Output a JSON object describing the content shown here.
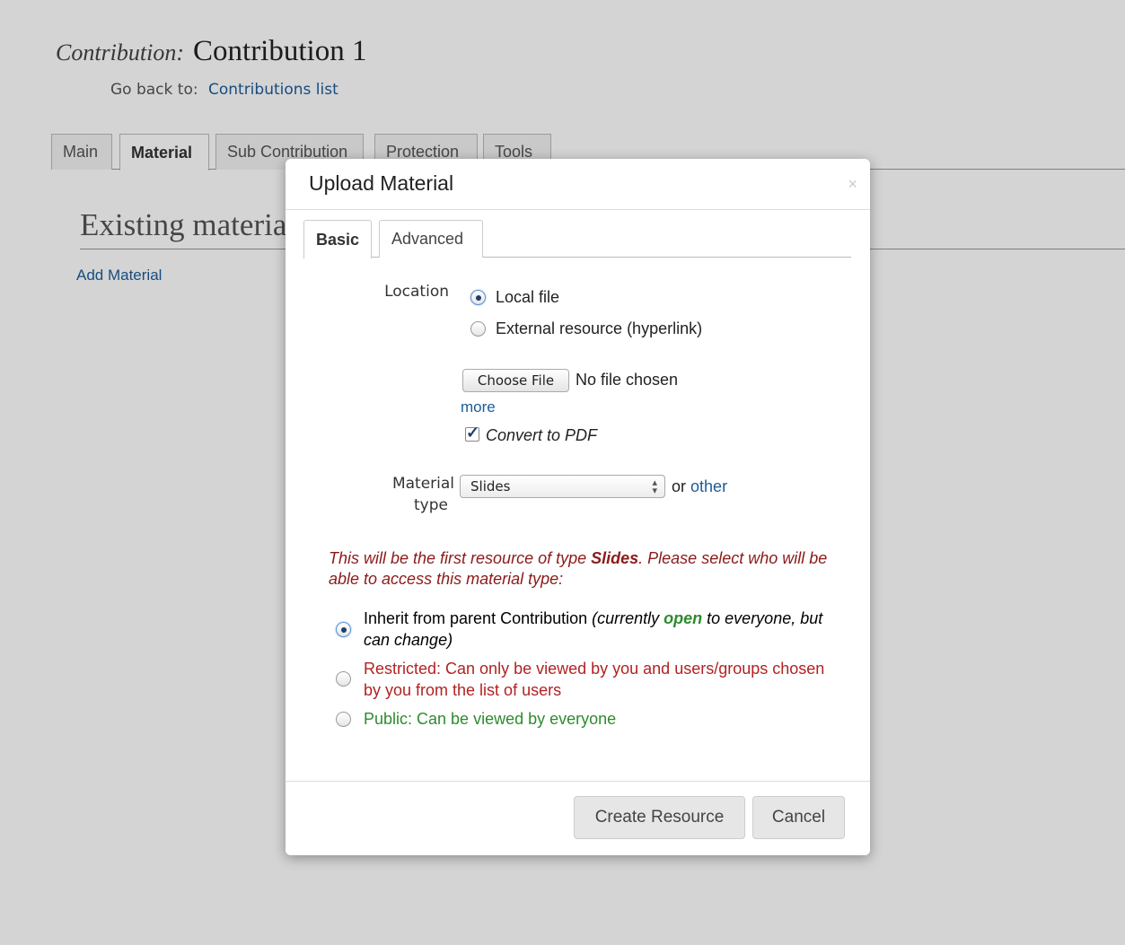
{
  "page": {
    "title_label": "Contribution:",
    "title_name": "Contribution 1",
    "goback_label": "Go back to:",
    "goback_link": "Contributions list",
    "tabs": [
      {
        "label": "Main"
      },
      {
        "label": "Material",
        "active": true
      },
      {
        "label": "Sub Contribution"
      },
      {
        "label": "Protection"
      },
      {
        "label": "Tools"
      }
    ],
    "section_title": "Existing material",
    "add_material": "Add Material"
  },
  "dialog": {
    "title": "Upload Material",
    "close_icon": "×",
    "tabs": [
      {
        "label": "Basic",
        "active": true
      },
      {
        "label": "Advanced"
      }
    ],
    "location": {
      "label": "Location",
      "options": [
        {
          "label": "Local file",
          "checked": true
        },
        {
          "label": "External resource (hyperlink)",
          "checked": false
        }
      ]
    },
    "file": {
      "button_label": "Choose File",
      "status": "No file chosen",
      "more_link": "more",
      "convert_label": "Convert to PDF",
      "convert_checked": true
    },
    "material_type": {
      "label_line1": "Material",
      "label_line2": "type",
      "selected": "Slides",
      "or_text": "or",
      "other_link": "other"
    },
    "access": {
      "warning_prefix": "This will be the first resource of type ",
      "warning_type": "Slides",
      "warning_suffix": ". Please select who will be able to access this material type:",
      "inherit_text": "Inherit from parent Contribution ",
      "inherit_note_prefix": "(currently ",
      "inherit_note_status": "open",
      "inherit_note_suffix": " to everyone, but can change)",
      "restricted_text": "Restricted: Can only be viewed by you and users/groups chosen by you from the list of users",
      "public_text": "Public: Can be viewed by everyone",
      "selected": "inherit"
    },
    "footer": {
      "create_label": "Create Resource",
      "cancel_label": "Cancel"
    }
  },
  "colors": {
    "link": "#1b5c99",
    "warning": "#8b1a1a",
    "restricted": "#b22222",
    "public": "#2e8b2e"
  }
}
